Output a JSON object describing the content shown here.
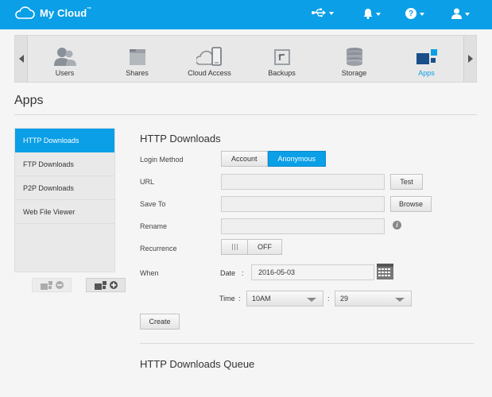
{
  "brand": {
    "name": "My Cloud",
    "tm": "™"
  },
  "topbar": {
    "icons": [
      "usb-icon",
      "bell-icon",
      "help-icon",
      "user-icon"
    ],
    "help_glyph": "?"
  },
  "nav": {
    "items": [
      {
        "label": "Users",
        "icon": "users-icon"
      },
      {
        "label": "Shares",
        "icon": "shares-icon"
      },
      {
        "label": "Cloud Access",
        "icon": "cloud-access-icon"
      },
      {
        "label": "Backups",
        "icon": "backups-icon"
      },
      {
        "label": "Storage",
        "icon": "storage-icon"
      },
      {
        "label": "Apps",
        "icon": "apps-icon",
        "active": true
      }
    ]
  },
  "page_title": "Apps",
  "side_menu": {
    "items": [
      {
        "label": "HTTP Downloads",
        "active": true
      },
      {
        "label": "FTP Downloads"
      },
      {
        "label": "P2P Downloads"
      },
      {
        "label": "Web File Viewer"
      }
    ]
  },
  "form": {
    "title": "HTTP Downloads",
    "login_method": {
      "label": "Login Method",
      "options": [
        "Account",
        "Anonymous"
      ],
      "selected": "Anonymous"
    },
    "url": {
      "label": "URL",
      "value": "",
      "test_label": "Test"
    },
    "save_to": {
      "label": "Save To",
      "value": "",
      "browse_label": "Browse"
    },
    "rename": {
      "label": "Rename",
      "value": "",
      "info_glyph": "i"
    },
    "recurrence": {
      "label": "Recurrence",
      "state": "OFF"
    },
    "when": {
      "label": "When",
      "date_label": "Date",
      "date_value": "2016-05-03",
      "time_label": "Time",
      "hour_value": "10AM",
      "minute_value": "29",
      "colon": ":"
    },
    "create_label": "Create"
  },
  "queue_title": "HTTP Downloads Queue",
  "colors": {
    "accent": "#0a9fe6",
    "background": "#f5f5f5"
  }
}
